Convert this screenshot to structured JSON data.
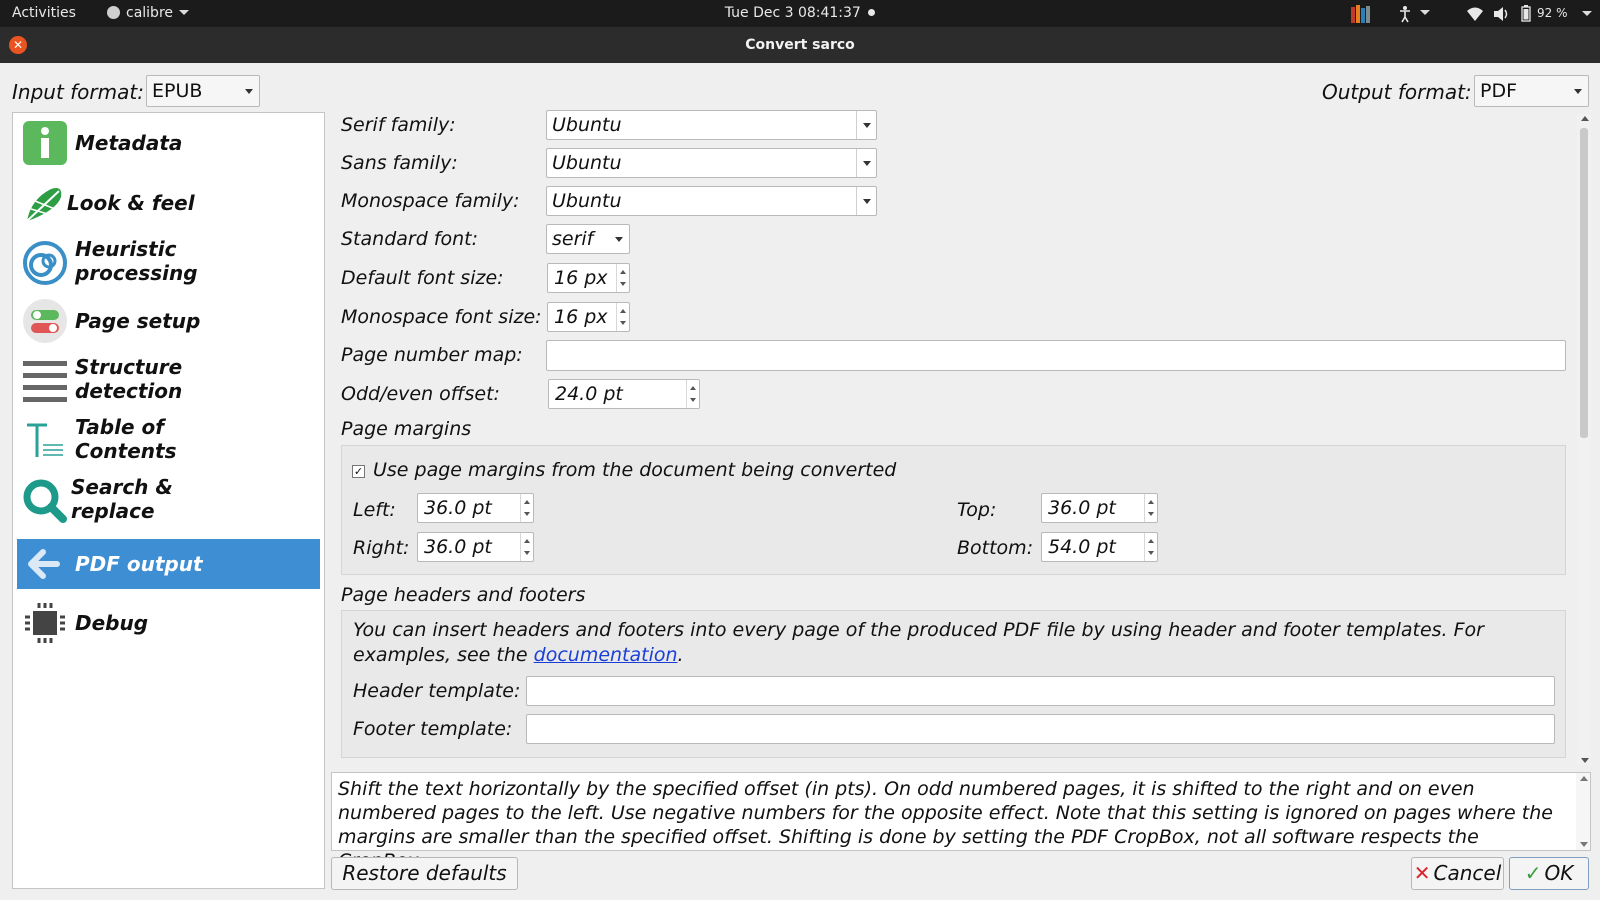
{
  "topbar": {
    "activities": "Activities",
    "app_name": "calibre",
    "clock": "Tue Dec 3  08:41:37",
    "battery": "92 %"
  },
  "window": {
    "title": "Convert sarco"
  },
  "formats": {
    "input_label": "Input format:",
    "input_value": "EPUB",
    "output_label": "Output format:",
    "output_value": "PDF"
  },
  "sidebar": {
    "items": [
      {
        "label_lines": [
          "Metadata"
        ],
        "icon": "info-icon"
      },
      {
        "label_lines": [
          "Look & feel"
        ],
        "icon": "brush-icon"
      },
      {
        "label_lines": [
          "Heuristic",
          "processing"
        ],
        "icon": "heuristic-icon"
      },
      {
        "label_lines": [
          "Page setup"
        ],
        "icon": "toggle-icon"
      },
      {
        "label_lines": [
          "Structure",
          "detection"
        ],
        "icon": "lines-icon"
      },
      {
        "label_lines": [
          "Table of",
          "Contents"
        ],
        "icon": "toc-icon"
      },
      {
        "label_lines": [
          "Search &",
          "replace"
        ],
        "icon": "search-icon"
      },
      {
        "label_lines": [
          "PDF output"
        ],
        "icon": "back-arrow-icon",
        "active": true
      },
      {
        "label_lines": [
          "Debug"
        ],
        "icon": "chip-icon"
      }
    ],
    "active_color": "#3d8ed2"
  },
  "fonts": {
    "serif_label": "Serif family:",
    "serif_value": "Ubuntu",
    "sans_label": "Sans family:",
    "sans_value": "Ubuntu",
    "mono_label": "Monospace family:",
    "mono_value": "Ubuntu",
    "standard_label": "Standard font:",
    "standard_value": "serif",
    "default_size_label": "Default font size:",
    "default_size_value": "16 px",
    "mono_size_label": "Monospace font size:",
    "mono_size_value": "16 px",
    "page_number_map_label": "Page number map:",
    "page_number_map_value": "",
    "odd_even_label": "Odd/even offset:",
    "odd_even_value": "24.0 pt"
  },
  "margins": {
    "title": "Page  margins",
    "use_doc_margins": "Use page margins from the document being converted",
    "use_doc_checked": true,
    "left_label": "Left:",
    "left_value": "36.0 pt",
    "right_label": "Right:",
    "right_value": "36.0 pt",
    "top_label": "Top:",
    "top_value": "36.0 pt",
    "bottom_label": "Bottom:",
    "bottom_value": "54.0 pt"
  },
  "headers": {
    "title": "Page headers and footers",
    "info_text": "You can insert headers and footers into every page of the produced PDF file by using header and footer templates. For examples, see the ",
    "link_text": "documentation",
    "info_end": ".",
    "header_label": "Header template:",
    "header_value": "",
    "footer_label": "Footer template:",
    "footer_value": ""
  },
  "help_text": "Shift the text horizontally by the specified offset (in pts). On odd numbered pages, it is shifted to the right and on even numbered pages to the left. Use negative numbers for the opposite effect. Note that this setting is ignored on pages where the margins are smaller than the specified offset. Shifting is done by setting the PDF CropBox, not all software respects the CropBox.",
  "buttons": {
    "restore": "Restore defaults",
    "cancel": "Cancel",
    "ok": "OK"
  }
}
